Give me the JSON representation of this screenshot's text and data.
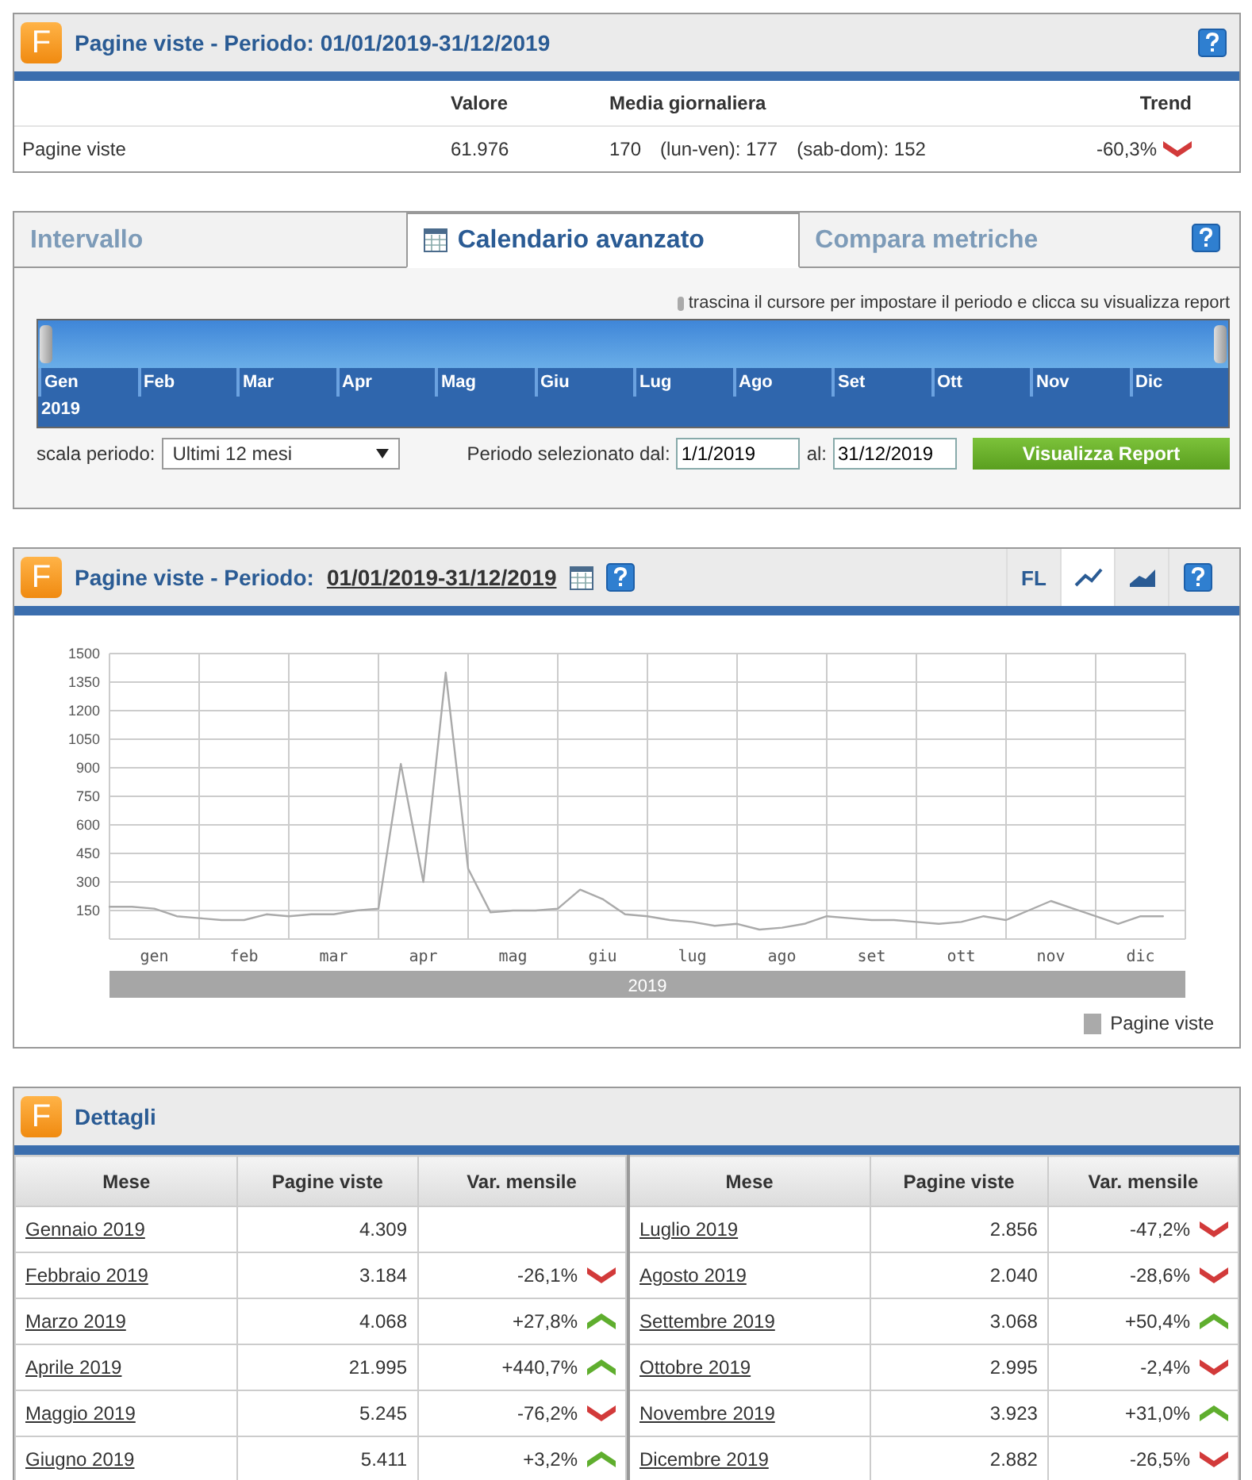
{
  "summary": {
    "logo_letter": "F",
    "title": "Pagine viste - Periodo: 01/01/2019-31/12/2019",
    "columns": [
      "Valore",
      "Media giornaliera",
      "Trend"
    ],
    "row": {
      "label": "Pagine viste",
      "value": "61.976",
      "daily": [
        "170",
        "(lun-ven): 177",
        "(sab-dom): 152"
      ],
      "trend": "-60,3%",
      "kind": "down"
    }
  },
  "calendar": {
    "tabs": [
      {
        "label": "Intervallo",
        "selected": false
      },
      {
        "label": "Calendario avanzato",
        "selected": true
      },
      {
        "label": "Compara metriche",
        "selected": false
      }
    ],
    "hint": "trascina il cursore per impostare il periodo e clicca su visualizza report",
    "months": [
      "Gen",
      "Feb",
      "Mar",
      "Apr",
      "Mag",
      "Giu",
      "Lug",
      "Ago",
      "Set",
      "Ott",
      "Nov",
      "Dic"
    ],
    "handles": [
      {
        "level": 0
      },
      {
        "level": 1
      }
    ],
    "year": "2019",
    "scale_label": "scala periodo:",
    "scale_value": "Ultimi 12 mesi",
    "from_label": "Periodo selezionato dal:",
    "from_value": "1/1/2019",
    "to_label": "al:",
    "to_value": "31/12/2019",
    "submit": "Visualizza Report"
  },
  "chart_panel": {
    "logo_letter": "F",
    "title": "Pagine viste - Periodo:",
    "period_link": "01/01/2019-31/12/2019",
    "toolbar": [
      {
        "kind": "text",
        "label": "FL",
        "selected": false
      },
      {
        "kind": "line",
        "selected": true
      },
      {
        "kind": "area",
        "selected": false
      }
    ],
    "year_band": "2019",
    "chart_data": {
      "type": "line",
      "grid": true,
      "ylim": [
        0,
        1500
      ],
      "yticks": [
        150,
        300,
        450,
        600,
        750,
        900,
        1050,
        1200,
        1350,
        1500
      ],
      "categories": [
        null,
        null,
        "gen",
        null,
        null,
        null,
        "feb",
        null,
        null,
        null,
        "mar",
        null,
        null,
        null,
        "apr",
        null,
        null,
        null,
        "mag",
        null,
        null,
        null,
        "giu",
        null,
        null,
        null,
        "lug",
        null,
        null,
        null,
        "ago",
        null,
        null,
        null,
        "set",
        null,
        null,
        null,
        "ott",
        null,
        null,
        null,
        "nov",
        null,
        null,
        null,
        "dic",
        null
      ],
      "series": [
        {
          "name": "Pagine viste",
          "color": "#aaaaaa",
          "values": [
            170,
            170,
            160,
            120,
            110,
            100,
            100,
            130,
            120,
            130,
            130,
            150,
            160,
            920,
            300,
            1400,
            370,
            140,
            150,
            150,
            160,
            260,
            210,
            130,
            120,
            100,
            90,
            70,
            80,
            50,
            60,
            80,
            120,
            110,
            100,
            100,
            90,
            80,
            90,
            120,
            100,
            150,
            200,
            160,
            120,
            80,
            120,
            120
          ]
        }
      ]
    }
  },
  "details": {
    "logo_letter": "F",
    "title": "Dettagli",
    "tables": [
      {
        "columns": [
          "Mese",
          "Pagine viste",
          "Var. mensile"
        ],
        "rows": [
          {
            "month": "Gennaio 2019",
            "views": "4.309"
          },
          {
            "month": "Febbraio 2019",
            "views": "3.184",
            "change": "-26,1%",
            "kind": "down"
          },
          {
            "month": "Marzo 2019",
            "views": "4.068",
            "change": "+27,8%",
            "kind": "up"
          },
          {
            "month": "Aprile 2019",
            "views": "21.995",
            "change": "+440,7%",
            "kind": "up"
          },
          {
            "month": "Maggio 2019",
            "views": "5.245",
            "change": "-76,2%",
            "kind": "down"
          },
          {
            "month": "Giugno 2019",
            "views": "5.411",
            "change": "+3,2%",
            "kind": "up"
          }
        ]
      },
      {
        "columns": [
          "Mese",
          "Pagine viste",
          "Var. mensile"
        ],
        "rows": [
          {
            "month": "Luglio 2019",
            "views": "2.856",
            "change": "-47,2%",
            "kind": "down"
          },
          {
            "month": "Agosto 2019",
            "views": "2.040",
            "change": "-28,6%",
            "kind": "down"
          },
          {
            "month": "Settembre 2019",
            "views": "3.068",
            "change": "+50,4%",
            "kind": "up"
          },
          {
            "month": "Ottobre 2019",
            "views": "2.995",
            "change": "-2,4%",
            "kind": "down"
          },
          {
            "month": "Novembre 2019",
            "views": "3.923",
            "change": "+31,0%",
            "kind": "up"
          },
          {
            "month": "Dicembre 2019",
            "views": "2.882",
            "change": "-26,5%",
            "kind": "down"
          }
        ]
      }
    ]
  }
}
